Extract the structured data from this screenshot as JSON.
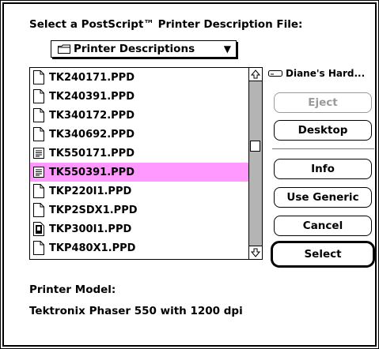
{
  "dialog": {
    "prompt": "Select a PostScript™ Printer Description File:",
    "folder_popup": {
      "label": "Printer Descriptions",
      "icon": "folder-icon"
    },
    "files": [
      {
        "name": "TK240171.PPD",
        "icon": "document-icon",
        "selected": false
      },
      {
        "name": "TK240391.PPD",
        "icon": "document-icon",
        "selected": false
      },
      {
        "name": "TK340172.PPD",
        "icon": "document-icon",
        "selected": false
      },
      {
        "name": "TK340692.PPD",
        "icon": "document-icon",
        "selected": false
      },
      {
        "name": "TK550171.PPD",
        "icon": "text-document-icon",
        "selected": false
      },
      {
        "name": "TK550391.PPD",
        "icon": "text-document-icon",
        "selected": true
      },
      {
        "name": "TKP220I1.PPD",
        "icon": "document-icon",
        "selected": false
      },
      {
        "name": "TKP2SDX1.PPD",
        "icon": "document-icon",
        "selected": false
      },
      {
        "name": "TKP300I1.PPD",
        "icon": "application-icon",
        "selected": false
      },
      {
        "name": "TKP480X1.PPD",
        "icon": "document-icon",
        "selected": false
      }
    ],
    "disk_label": "Diane's Hard...",
    "buttons": {
      "eject": "Eject",
      "desktop": "Desktop",
      "info": "Info",
      "use_generic": "Use Generic",
      "cancel": "Cancel",
      "select": "Select"
    },
    "printer_model_label": "Printer Model:",
    "printer_model_value": "Tektronix Phaser 550 with 1200 dpi"
  },
  "colors": {
    "selection": "#ff99ff",
    "scrollbar_track": "#c8c8c8",
    "disabled_text": "#9a9a9a"
  }
}
